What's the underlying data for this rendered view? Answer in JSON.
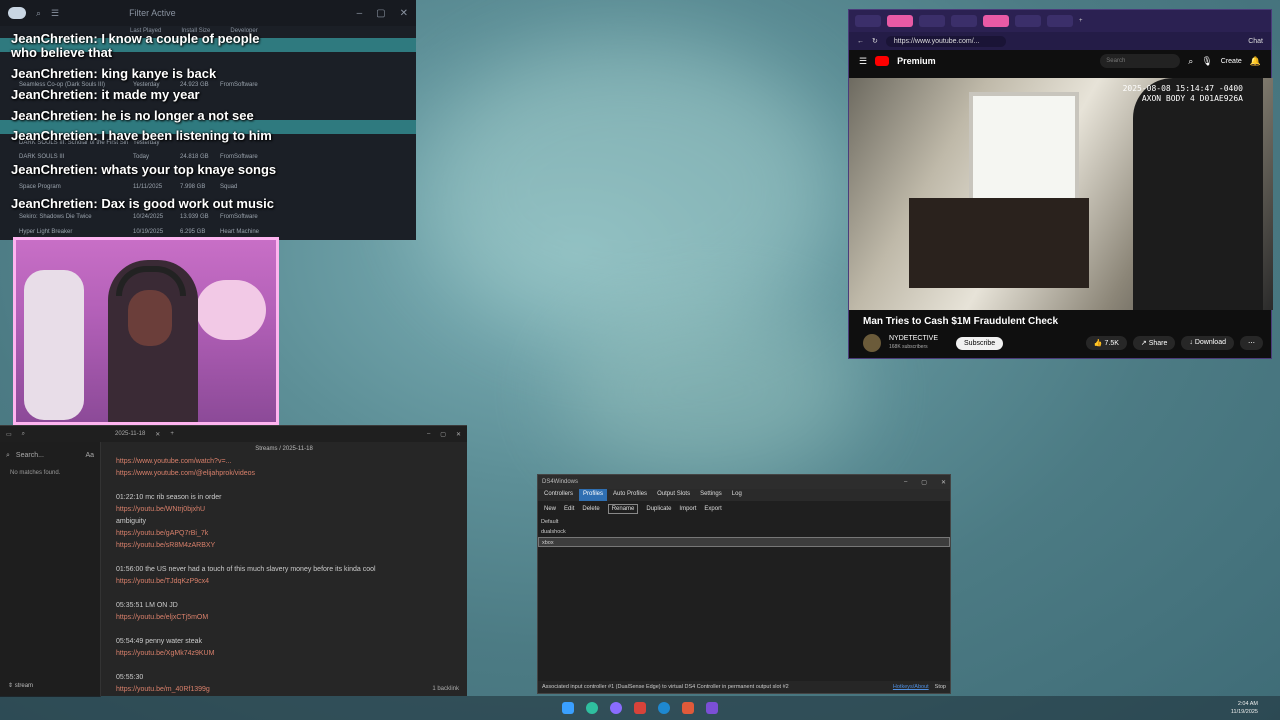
{
  "steam": {
    "toolbar": [
      "Filter Active"
    ],
    "columns": [
      "Last Played",
      "Install Size",
      "Developer"
    ],
    "rows": [
      {
        "name": "Seamless Co-op (Dark Souls III)",
        "played": "Yesterday",
        "size": "24.923 GB",
        "dev": "FromSoftware"
      },
      {
        "name": "DARK SOULS III: Scholar of the First Sin",
        "played": "Yesterday",
        "size": "",
        "dev": ""
      },
      {
        "name": "DARK SOULS III",
        "played": "Today",
        "size": "24.818 GB",
        "dev": "FromSoftware"
      },
      {
        "name": "Space Program",
        "played": "11/11/2025",
        "size": "7.998 GB",
        "dev": "Squad"
      },
      {
        "name": "Sekiro: Shadows Die Twice",
        "played": "10/24/2025",
        "size": "13.939 GB",
        "dev": "FromSoftware"
      },
      {
        "name": "Hyper Light Breaker",
        "played": "10/19/2025",
        "size": "6.295 GB",
        "dev": "Heart Machine"
      }
    ]
  },
  "chat": [
    {
      "user": "JeanChretien:",
      "msg": "I know a couple of people who believe that"
    },
    {
      "user": "JeanChretien:",
      "msg": "king kanye is back"
    },
    {
      "user": "JeanChretien:",
      "msg": "it made my year"
    },
    {
      "user": "JeanChretien:",
      "msg": "he is no longer a not see"
    },
    {
      "user": "JeanChretien:",
      "msg": "I have been listening to him"
    },
    {
      "user": "JeanChretien:",
      "msg": "whats your top knaye songs"
    },
    {
      "user": "JeanChretien:",
      "msg": "Dax is good work out music"
    }
  ],
  "notes": {
    "tab_date": "2025-11-18",
    "search_placeholder": "Search...",
    "no_matches": "No matches found.",
    "vault": "stream",
    "breadcrumb": "Streams / 2025-11-18",
    "lines": [
      {
        "t": "link",
        "v": "https://www.youtube.com/watch?v=..."
      },
      {
        "t": "link",
        "v": "https://www.youtube.com/@elijahprok/videos"
      },
      {
        "t": "gap",
        "v": ""
      },
      {
        "t": "text",
        "v": "01:22:10 mc rib season is in order"
      },
      {
        "t": "link",
        "v": "https://youtu.be/WNtrj0bjxhU"
      },
      {
        "t": "text",
        "v": "ambiguity"
      },
      {
        "t": "link",
        "v": "https://youtu.be/gAPQ7rBi_7k"
      },
      {
        "t": "link",
        "v": "https://youtu.be/sR8M4zARBXY"
      },
      {
        "t": "gap",
        "v": ""
      },
      {
        "t": "text",
        "v": "01:56:00 the US never had a touch of this much slavery money before its kinda cool"
      },
      {
        "t": "link",
        "v": "https://youtu.be/TJdqKzP9cx4"
      },
      {
        "t": "gap",
        "v": ""
      },
      {
        "t": "text",
        "v": "05:35:51 LM ON JD"
      },
      {
        "t": "link",
        "v": "https://youtu.be/eljxCTj5mOM"
      },
      {
        "t": "gap",
        "v": ""
      },
      {
        "t": "text",
        "v": "05:54:49 penny water steak"
      },
      {
        "t": "link",
        "v": "https://youtu.be/XgMk74z9KUM"
      },
      {
        "t": "gap",
        "v": ""
      },
      {
        "t": "text",
        "v": "05:55:30"
      },
      {
        "t": "link",
        "v": "https://youtu.be/m_40Rf1399g"
      }
    ],
    "backlink": "1 backlink"
  },
  "browser": {
    "url": "https://www.youtube.com/...",
    "brand": "Premium",
    "search_placeholder": "Search",
    "create_label": "Create",
    "chat_label": "Chat",
    "stamp_line1": "2025-08-08 15:14:47 -0400",
    "stamp_line2": "AXON BODY 4 D01AE926A",
    "video_title": "Man Tries to Cash $1M Fraudulent Check",
    "channel": "NYDETECTIVE",
    "subs": "168K subscribers",
    "subscribe": "Subscribe",
    "likes": "7.5K",
    "share": "Share",
    "download": "Download"
  },
  "ds4": {
    "title": "DS4Windows",
    "tabs": [
      "Controllers",
      "Profiles",
      "Auto Profiles",
      "Output Slots",
      "Settings",
      "Log"
    ],
    "tools": [
      "New",
      "Edit",
      "Delete",
      "Rename",
      "Duplicate",
      "Import",
      "Export"
    ],
    "profiles": [
      "Default",
      "dualshock",
      "xbox"
    ],
    "status": "Associated input controller #1 (DualSense Edge) to virtual DS4 Controller in permanent output slot #2",
    "hotkeys": "Hotkeys/About",
    "stop": "Stop"
  },
  "clock": {
    "time": "2:04 AM",
    "date": "11/19/2025"
  }
}
